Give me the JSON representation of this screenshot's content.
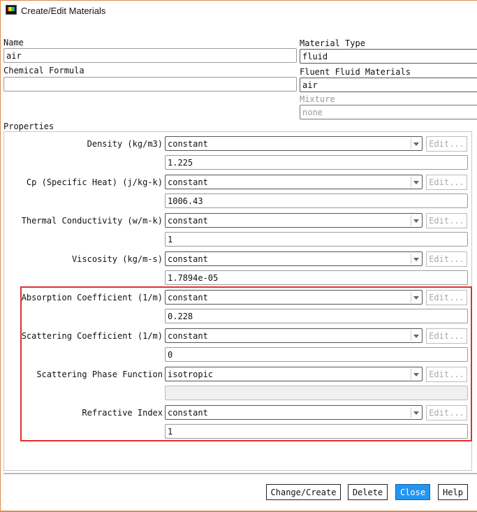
{
  "window": {
    "title": "Create/Edit Materials"
  },
  "name": {
    "label": "Name",
    "value": "air"
  },
  "chemical_formula": {
    "label": "Chemical Formula",
    "value": ""
  },
  "material_type": {
    "label": "Material Type",
    "value": "fluid"
  },
  "fluent_fluid_materials": {
    "label": "Fluent Fluid Materials",
    "value": "air"
  },
  "mixture": {
    "label": "Mixture",
    "value": "none"
  },
  "properties": {
    "label": "Properties",
    "edit_label": "Edit...",
    "rows": [
      {
        "label": "Density (kg/m3)",
        "method": "constant",
        "value": "1.225"
      },
      {
        "label": "Cp (Specific Heat) (j/kg-k)",
        "method": "constant",
        "value": "1006.43"
      },
      {
        "label": "Thermal Conductivity (w/m-k)",
        "method": "constant",
        "value": "1"
      },
      {
        "label": "Viscosity (kg/m-s)",
        "method": "constant",
        "value": "1.7894e-05"
      },
      {
        "label": "Absorption Coefficient (1/m)",
        "method": "constant",
        "value": "0.228"
      },
      {
        "label": "Scattering Coefficient (1/m)",
        "method": "constant",
        "value": "0"
      },
      {
        "label": "Scattering Phase Function",
        "method": "isotropic",
        "value": ""
      },
      {
        "label": "Refractive Index",
        "method": "constant",
        "value": "1"
      }
    ]
  },
  "buttons": {
    "change_create": "Change/Create",
    "delete": "Delete",
    "close": "Close",
    "help": "Help"
  },
  "colors": {
    "highlight": "#e03030",
    "primary": "#2196f3",
    "window_border": "#e08a4a"
  }
}
